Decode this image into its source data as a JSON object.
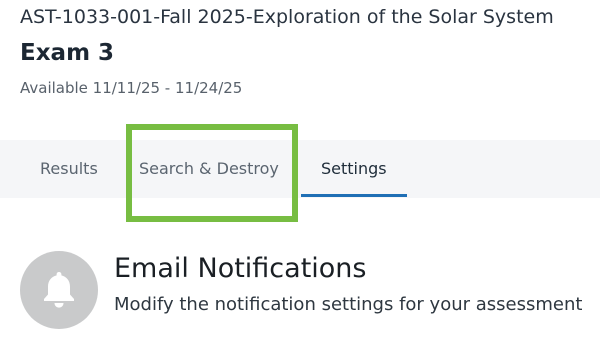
{
  "header": {
    "course_title": "AST-1033-001-Fall 2025-Exploration of the Solar System",
    "exam_title": "Exam 3",
    "availability": "Available 11/11/25 - 11/24/25"
  },
  "tabs": {
    "results": "Results",
    "search_destroy": "Search & Destroy",
    "settings": "Settings",
    "active": "Settings"
  },
  "highlight": {
    "color": "#77bd42",
    "target": "Search & Destroy"
  },
  "notifications": {
    "icon": "bell-icon",
    "title": "Email Notifications",
    "description": "Modify the notification settings for your assessment"
  },
  "colors": {
    "accent": "#1f6fb5",
    "tabbar_bg": "#f5f6f8",
    "icon_circle": "#c9cacb"
  }
}
